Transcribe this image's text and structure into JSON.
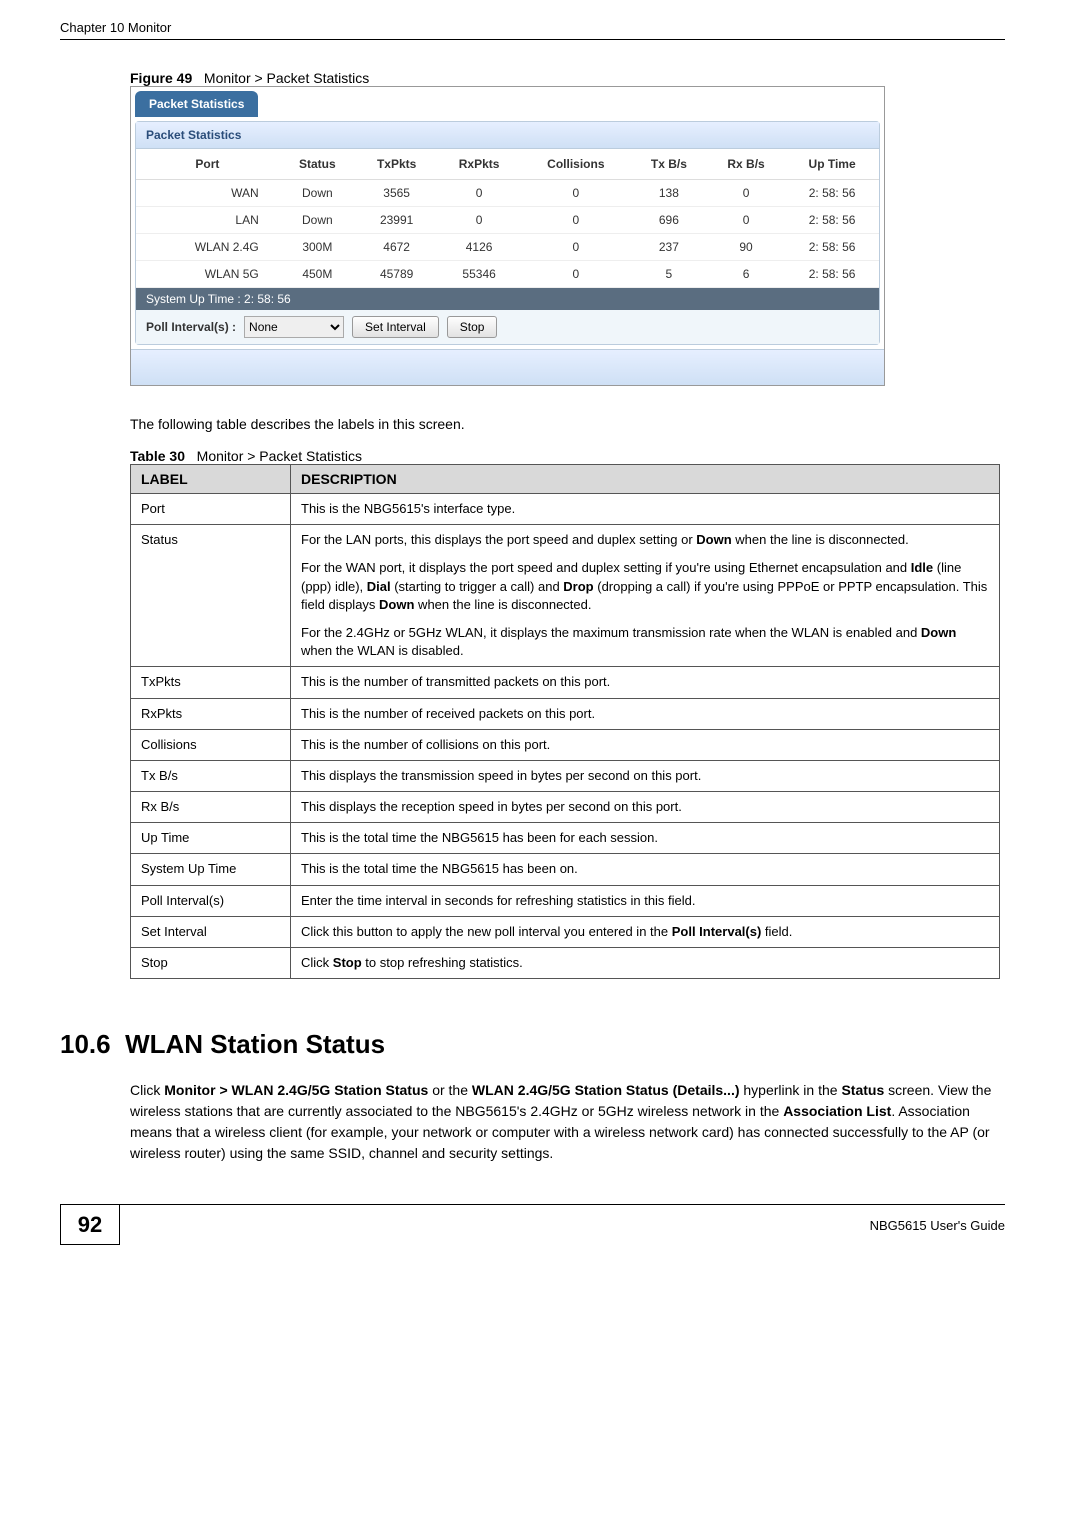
{
  "header": {
    "chapter": "Chapter 10 Monitor"
  },
  "figure": {
    "label": "Figure 49",
    "title": "Monitor > Packet Statistics",
    "tab": "Packet Statistics",
    "panel_title": "Packet Statistics",
    "columns": [
      "Port",
      "Status",
      "TxPkts",
      "RxPkts",
      "Collisions",
      "Tx B/s",
      "Rx B/s",
      "Up Time"
    ],
    "rows": [
      [
        "WAN",
        "Down",
        "3565",
        "0",
        "0",
        "138",
        "0",
        "2: 58: 56"
      ],
      [
        "LAN",
        "Down",
        "23991",
        "0",
        "0",
        "696",
        "0",
        "2: 58: 56"
      ],
      [
        "WLAN 2.4G",
        "300M",
        "4672",
        "4126",
        "0",
        "237",
        "90",
        "2: 58: 56"
      ],
      [
        "WLAN 5G",
        "450M",
        "45789",
        "55346",
        "0",
        "5",
        "6",
        "2: 58: 56"
      ]
    ],
    "system_uptime_label": "System Up Time : 2: 58: 56",
    "poll_label": "Poll Interval(s) :",
    "poll_select": "None",
    "btn_set": "Set Interval",
    "btn_stop": "Stop"
  },
  "intro_text": "The following table describes the labels in this screen.",
  "desc_table": {
    "caption_label": "Table 30",
    "caption_title": "Monitor > Packet Statistics",
    "head_label": "LABEL",
    "head_desc": "DESCRIPTION",
    "rows": [
      {
        "label": "Port",
        "desc": "This is the NBG5615's interface type."
      },
      {
        "label": "Status",
        "desc_p1": "For the LAN ports, this displays the port speed and duplex setting or <b>Down</b> when the line is disconnected.",
        "desc_p2": "For the WAN port, it displays the port speed and duplex setting if you're using Ethernet encapsulation and <b>Idle</b> (line (ppp) idle), <b>Dial</b> (starting to trigger a call) and <b>Drop</b> (dropping a call) if you're using PPPoE or PPTP encapsulation. This field displays <b>Down</b> when the line is disconnected.",
        "desc_p3": "For the 2.4GHz or 5GHz WLAN, it displays the maximum transmission rate when the WLAN is enabled and <b>Down</b> when the WLAN is disabled."
      },
      {
        "label": "TxPkts",
        "desc": "This is the number of transmitted packets on this port."
      },
      {
        "label": "RxPkts",
        "desc": "This is the number of received packets on this port."
      },
      {
        "label": "Collisions",
        "desc": "This is the number of collisions on this port."
      },
      {
        "label": "Tx B/s",
        "desc": "This displays the transmission speed in bytes per second on this port."
      },
      {
        "label": "Rx B/s",
        "desc": "This displays the reception speed in bytes per second on this port."
      },
      {
        "label": "Up Time",
        "desc": "This is the total time the NBG5615 has been for each session."
      },
      {
        "label": "System Up Time",
        "desc": "This is the total time the NBG5615 has been on."
      },
      {
        "label": "Poll Interval(s)",
        "desc": "Enter the time interval in seconds for refreshing statistics in this field."
      },
      {
        "label": "Set Interval",
        "desc": "Click this button to apply the new poll interval you entered in the <b>Poll Interval(s)</b> field."
      },
      {
        "label": "Stop",
        "desc": "Click <b>Stop</b> to stop refreshing statistics."
      }
    ]
  },
  "section": {
    "number": "10.6",
    "title": "WLAN Station Status",
    "body": "Click <b>Monitor &gt; WLAN 2.4G/5G Station Status</b> or the <b>WLAN 2.4G/5G Station Status (Details...)</b> hyperlink in the <b>Status</b> screen. View the wireless stations that are currently associated to the NBG5615's 2.4GHz or 5GHz wireless network in the <b>Association List</b>. Association means that a wireless client (for example, your network or computer with a wireless network card) has connected successfully to the AP (or wireless router) using the same SSID, channel and security settings."
  },
  "footer": {
    "page": "92",
    "guide": "NBG5615 User's Guide"
  }
}
